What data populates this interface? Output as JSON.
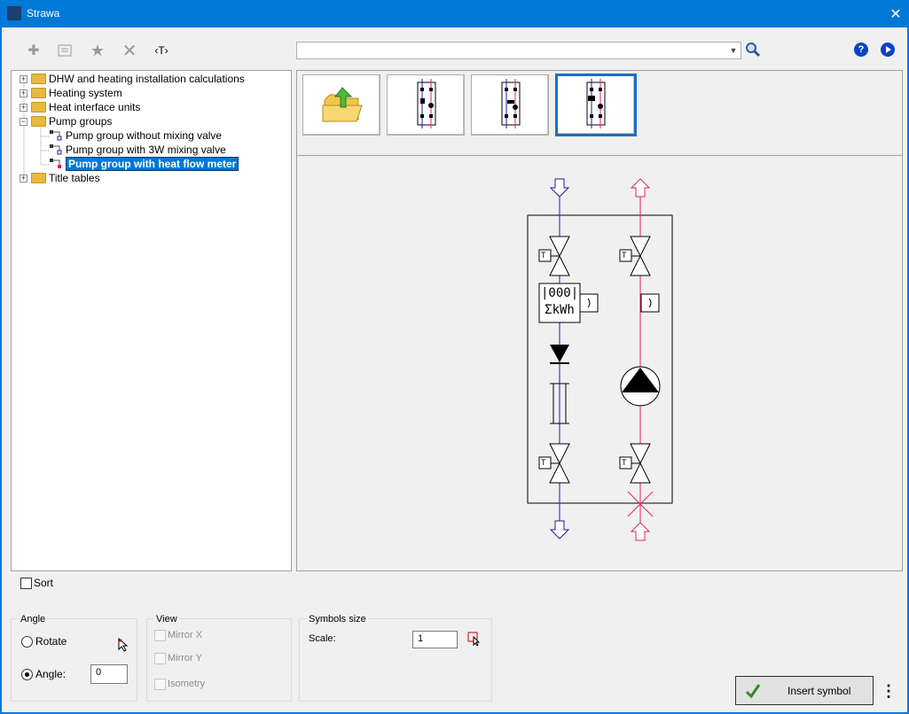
{
  "window": {
    "title": "Strawa",
    "close_icon": "close-icon"
  },
  "toolbar": {
    "add_icon": "plus-icon",
    "properties_icon": "properties-icon",
    "favorite_icon": "star-icon",
    "delete_icon": "delete-icon",
    "text_label": "‹T›",
    "search_value": "",
    "search_icon": "search-icon",
    "help_icon_label": "?",
    "next_icon": "play-icon"
  },
  "tree": {
    "items": [
      {
        "label": "DHW and heating installation calculations",
        "type": "folder",
        "expanded": false
      },
      {
        "label": "Heating system",
        "type": "folder",
        "expanded": false
      },
      {
        "label": "Heat interface units",
        "type": "folder",
        "expanded": false
      },
      {
        "label": "Pump groups",
        "type": "folder",
        "expanded": true
      },
      {
        "label": "Pump group without mixing valve",
        "type": "leaf"
      },
      {
        "label": "Pump group with 3W mixing valve",
        "type": "leaf"
      },
      {
        "label": "Pump group with heat flow meter",
        "type": "leaf",
        "selected": true
      },
      {
        "label": "Title tables",
        "type": "folder",
        "expanded": false
      }
    ]
  },
  "preview": {
    "meter_top": "|000|",
    "meter_bottom": "ΣkWh",
    "temp_label": "T"
  },
  "sort": {
    "label": "Sort",
    "checked": false
  },
  "angle": {
    "title": "Angle",
    "rotate_label": "Rotate",
    "angle_label": "Angle:",
    "angle_value": "0",
    "selected": "angle"
  },
  "view": {
    "title": "View",
    "mirror_x": "Mirror X",
    "mirror_y": "Mirror Y",
    "isometry": "Isometry"
  },
  "symbols_size": {
    "title": "Symbols size",
    "scale_label": "Scale:",
    "scale_value": "1"
  },
  "actions": {
    "insert_label": "Insert symbol",
    "more_label": "⋮"
  },
  "colors": {
    "accent": "#0078d7",
    "supply": "#e0206a",
    "return": "#1a1aa8"
  }
}
